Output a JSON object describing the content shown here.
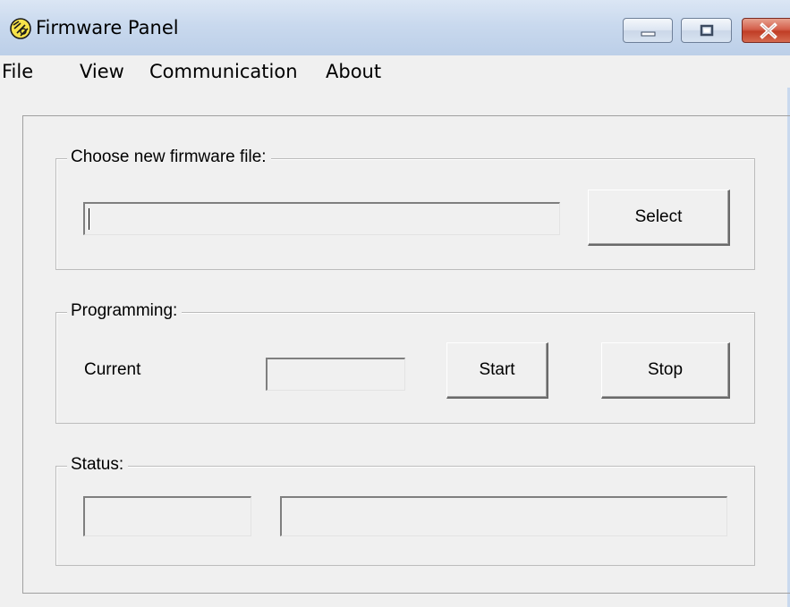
{
  "window": {
    "title": "Firmware Panel",
    "icon": "firmware-app-icon",
    "controls": {
      "minimize": "minimize-icon",
      "maximize": "maximize-icon",
      "close": "close-icon"
    }
  },
  "menu": {
    "items": [
      "File",
      "View",
      "Communication",
      "About"
    ]
  },
  "firmware_group": {
    "label": "Choose new firmware file:",
    "file_value": "",
    "select_label": "Select"
  },
  "programming_group": {
    "label": "Programming:",
    "current_label": "Current",
    "current_value": "",
    "start_label": "Start",
    "stop_label": "Stop"
  },
  "status_group": {
    "label": "Status:",
    "status_code": "",
    "status_message": ""
  },
  "colors": {
    "titlebar": "#c9d9ee",
    "window_bg": "#f0f0f0",
    "close_button": "#c9452e"
  }
}
